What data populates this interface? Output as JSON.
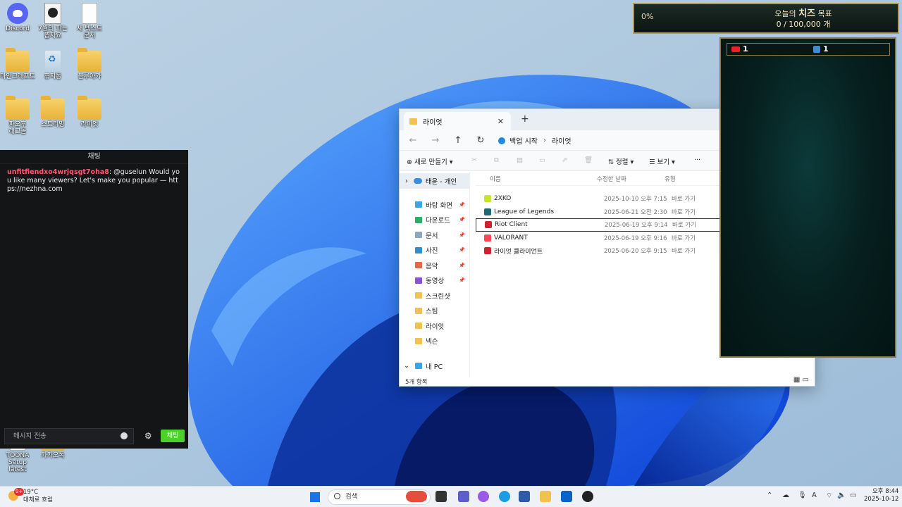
{
  "desktop": {
    "icons": [
      {
        "label": "Discord",
        "kind": "discord"
      },
      {
        "label": "7월의 피는 뽑자요",
        "kind": "video"
      },
      {
        "label": "새 텍스트 문서",
        "kind": "doc"
      },
      {
        "label": "마인크래프트",
        "kind": "folder"
      },
      {
        "label": "휴지통",
        "kind": "recycle"
      },
      {
        "label": "블루아카",
        "kind": "folder"
      },
      {
        "label": "파오후 래그돌",
        "kind": "folder"
      },
      {
        "label": "스트리밍",
        "kind": "folder"
      },
      {
        "label": "라이엇",
        "kind": "folder"
      },
      {
        "label": "TOONA Setup latest",
        "kind": "doc"
      },
      {
        "label": "카카오톡",
        "kind": "folder"
      }
    ]
  },
  "chat": {
    "title": "채팅",
    "message_user": "unfitfiendxo4wrjqsgt7oha8",
    "message_text": ": @guselun Would you like many viewers? Let's make you popular — https://nezhna.com",
    "input_placeholder": "메시지 전송",
    "send_label": "채팅"
  },
  "explorer": {
    "tab_title": "라이엇",
    "breadcrumb": [
      "백업 시작",
      "라이엇"
    ],
    "toolbar": {
      "new_label": "새로 만들기",
      "sort_label": "정렬",
      "view_label": "보기",
      "more_label": "···"
    },
    "sidebar": {
      "top_item": "태윤 - 개인",
      "items": [
        {
          "label": "바탕 화면",
          "color": "#3aa6e8",
          "pinned": true
        },
        {
          "label": "다운로드",
          "color": "#2fae6a",
          "pinned": true
        },
        {
          "label": "문서",
          "color": "#8da6c4",
          "pinned": true
        },
        {
          "label": "사진",
          "color": "#2b8fd6",
          "pinned": true
        },
        {
          "label": "음악",
          "color": "#e06b4a",
          "pinned": true
        },
        {
          "label": "동영상",
          "color": "#8a53c9",
          "pinned": true
        },
        {
          "label": "스크린샷",
          "color": "#f2c14e",
          "pinned": false
        },
        {
          "label": "스팀",
          "color": "#f2c14e",
          "pinned": false
        },
        {
          "label": "라이엇",
          "color": "#f2c14e",
          "pinned": false
        },
        {
          "label": "넥슨",
          "color": "#f2c14e",
          "pinned": false
        }
      ],
      "bottom_item": "내 PC"
    },
    "columns": {
      "name": "이름",
      "date": "수정한 날짜",
      "type": "유형"
    },
    "files": [
      {
        "name": "2XKO",
        "date": "2025-10-10 오후 7:15",
        "type": "바로 가기",
        "color": "#c9e234",
        "selected": false
      },
      {
        "name": "League of Legends",
        "date": "2025-06-21 오전 2:30",
        "type": "바로 가기",
        "color": "#1d6a75",
        "selected": false
      },
      {
        "name": "Riot Client",
        "date": "2025-06-19 오후 9:14",
        "type": "바로 가기",
        "color": "#d3202e",
        "selected": true
      },
      {
        "name": "VALORANT",
        "date": "2025-06-19 오후 9:16",
        "type": "바로 가기",
        "color": "#ff4655",
        "selected": false
      },
      {
        "name": "라이엇 클라이언트",
        "date": "2025-06-20 오후 9:15",
        "type": "바로 가기",
        "color": "#d3202e",
        "selected": false
      }
    ],
    "status": "5개 항목"
  },
  "overlay": {
    "goal_percent": "0%",
    "goal_title_prefix": "오늘의",
    "goal_title_bold": "치즈",
    "goal_title_suffix": "목표",
    "goal_count": "0 / 100,000 개",
    "youtube_count": "1",
    "chzzk_count": "1"
  },
  "taskbar": {
    "weather_temp": "19°C",
    "weather_desc": "대체로 흐림",
    "weather_badge": "9+",
    "search_placeholder": "검색",
    "clock_time": "오후 8:44",
    "clock_date": "2025-10-12",
    "tray_ime": "A"
  }
}
